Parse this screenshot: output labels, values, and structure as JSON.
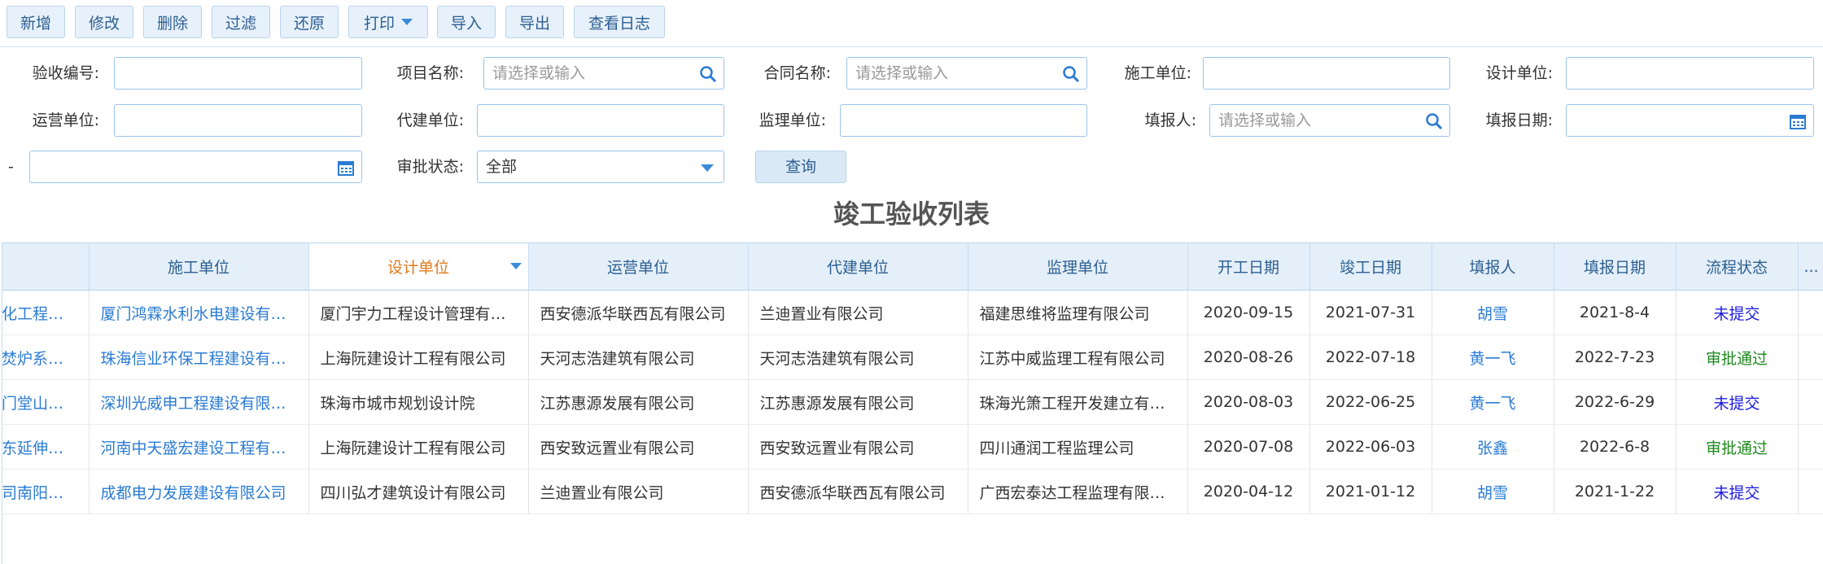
{
  "toolbar": {
    "add": "新增",
    "edit": "修改",
    "delete": "删除",
    "filter": "过滤",
    "restore": "还原",
    "print": "打印",
    "import": "导入",
    "export": "导出",
    "log": "查看日志"
  },
  "form": {
    "acceptance_no_label": "验收编号:",
    "project_name_label": "项目名称:",
    "project_name_placeholder": "请选择或输入",
    "contract_name_label": "合同名称:",
    "contract_name_placeholder": "请选择或输入",
    "construction_unit_label": "施工单位:",
    "design_unit_label": "设计单位:",
    "operation_unit_label": "运营单位:",
    "agent_unit_label": "代建单位:",
    "supervision_unit_label": "监理单位:",
    "reporter_label": "填报人:",
    "reporter_placeholder": "请选择或输入",
    "report_date_label": "填报日期:",
    "range_dash": "-",
    "approval_status_label": "审批状态:",
    "approval_status_value": "全部",
    "query_button": "查询"
  },
  "table_title": "竣工验收列表",
  "columns": [
    "",
    "施工单位",
    "设计单位",
    "运营单位",
    "代建单位",
    "监理单位",
    "开工日期",
    "竣工日期",
    "填报人",
    "填报日期",
    "流程状态",
    "..."
  ],
  "rows": [
    [
      "化工程…",
      "厦门鸿霖水利水电建设有…",
      "厦门宇力工程设计管理有…",
      "西安德派华联西瓦有限公司",
      "兰迪置业有限公司",
      "福建思维将监理有限公司",
      "2020-09-15",
      "2021-07-31",
      "胡雪",
      "2021-8-4",
      "未提交"
    ],
    [
      "焚炉系…",
      "珠海信业环保工程建设有…",
      "上海阮建设计工程有限公司",
      "天河志浩建筑有限公司",
      "天河志浩建筑有限公司",
      "江苏中威监理工程有限公司",
      "2020-08-26",
      "2022-07-18",
      "黄一飞",
      "2022-7-23",
      "审批通过"
    ],
    [
      "门堂山…",
      "深圳光威申工程建设有限…",
      "珠海市城市规划设计院",
      "江苏惠源发展有限公司",
      "江苏惠源发展有限公司",
      "珠海光箫工程开发建立有…",
      "2020-08-03",
      "2022-06-25",
      "黄一飞",
      "2022-6-29",
      "未提交"
    ],
    [
      "东延伸…",
      "河南中天盛宏建设工程有…",
      "上海阮建设计工程有限公司",
      "西安致远置业有限公司",
      "西安致远置业有限公司",
      "四川通润工程监理公司",
      "2020-07-08",
      "2022-06-03",
      "张鑫",
      "2022-6-8",
      "审批通过"
    ],
    [
      "司南阳…",
      "成都电力发展建设有限公司",
      "四川弘才建筑设计有限公司",
      "兰迪置业有限公司",
      "西安德派华联西瓦有限公司",
      "广西宏泰达工程监理有限…",
      "2020-04-12",
      "2021-01-12",
      "胡雪",
      "2021-1-22",
      "未提交"
    ]
  ],
  "colors": {
    "draft": "#1a1ae0",
    "approved": "#1e8a1e",
    "link": "#2a7bd3",
    "sorted_header": "#e17a1c"
  }
}
